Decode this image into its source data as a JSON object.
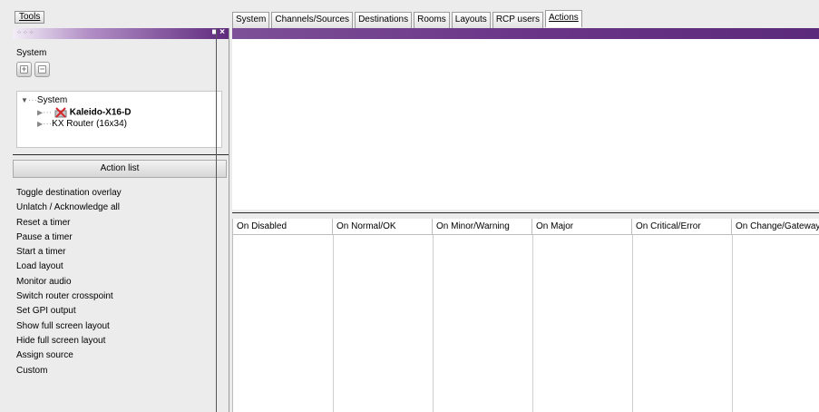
{
  "toolbar": {
    "tools_label": "Tools"
  },
  "tabs": [
    {
      "label": "System"
    },
    {
      "label": "Channels/Sources"
    },
    {
      "label": "Destinations"
    },
    {
      "label": "Rooms"
    },
    {
      "label": "Layouts"
    },
    {
      "label": "RCP users"
    },
    {
      "label": "Actions"
    }
  ],
  "active_tab": "Actions",
  "left_panel": {
    "window_controls": "■ ×",
    "section_label": "System",
    "buttons": {
      "add_symbol": "+",
      "remove_symbol": "−"
    },
    "tree": {
      "root": "System",
      "children": [
        "Kaleido-X16-D",
        "KX Router (16x34)"
      ]
    },
    "action_list_header": "Action list",
    "actions": [
      "Toggle destination overlay",
      "Unlatch / Acknowledge all",
      "Reset a timer",
      "Pause a timer",
      "Start a timer",
      "Load layout",
      "Monitor audio",
      "Switch router crosspoint",
      "Set GPI output",
      "Show full screen layout",
      "Hide full screen layout",
      "Assign source",
      "Custom"
    ]
  },
  "status_grid": {
    "columns": [
      "On Disabled",
      "On Normal/OK",
      "On Minor/Warning",
      "On Major",
      "On Critical/Error",
      "On Change/Gateway"
    ]
  },
  "colors": {
    "title_bar_purple": "#5f2a7d",
    "error_icon_red": "#d6262c"
  }
}
